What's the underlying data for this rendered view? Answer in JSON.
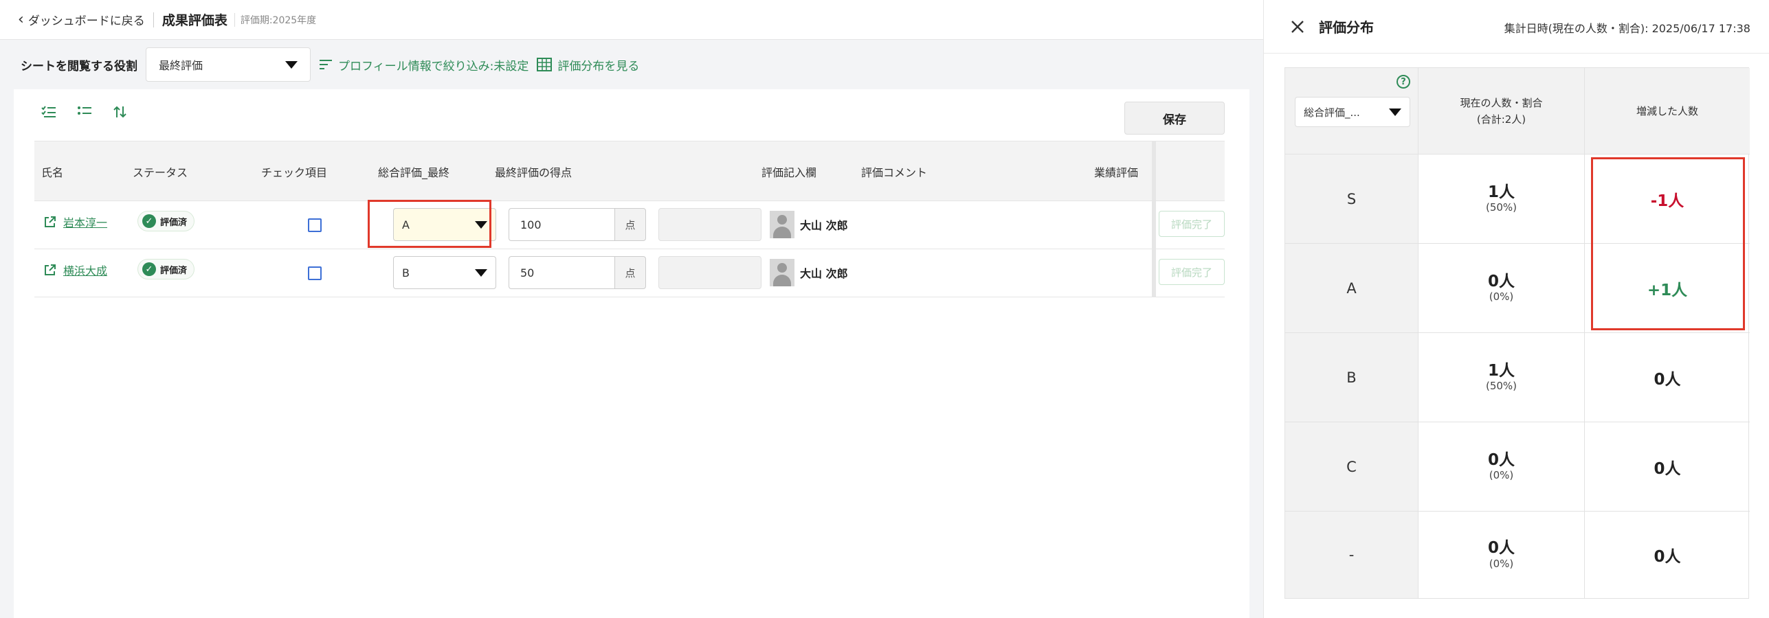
{
  "header": {
    "back_label": "ダッシュボードに戻る",
    "title": "成果評価表",
    "period": "評価期:2025年度"
  },
  "filterbar": {
    "role_label": "シートを閲覧する役割",
    "role_value": "最終評価",
    "profile_filter": "プロフィール情報で絞り込み:未設定",
    "distribution_link": "評価分布を見る"
  },
  "toolbar": {
    "save_label": "保存"
  },
  "table": {
    "columns": [
      "氏名",
      "ステータス",
      "チェック項目",
      "総合評価_最終",
      "最終評価の得点",
      "評価記入欄",
      "評価コメント",
      "業績評価"
    ],
    "rows": [
      {
        "name": "岩本淳一",
        "status": "評価済",
        "grade": "A",
        "score": "100",
        "unit": "点",
        "evaluator": "大山 次郎",
        "action": "評価完了"
      },
      {
        "name": "横浜大成",
        "status": "評価済",
        "grade": "B",
        "score": "50",
        "unit": "点",
        "evaluator": "大山 次郎",
        "action": "評価完了"
      }
    ]
  },
  "panel": {
    "title": "評価分布",
    "aggregated_at": "集計日時(現在の人数・割合):  2025/06/17 17:38",
    "select_value": "総合評価_...",
    "col_current": "現在の人数・割合",
    "col_current_sub": "(合計:2人)",
    "col_change": "増減した人数",
    "rows": [
      {
        "grade": "S",
        "count": "1人",
        "pct": "(50%)",
        "diff": "-1人"
      },
      {
        "grade": "A",
        "count": "0人",
        "pct": "(0%)",
        "diff": "+1人"
      },
      {
        "grade": "B",
        "count": "1人",
        "pct": "(50%)",
        "diff": "0人"
      },
      {
        "grade": "C",
        "count": "0人",
        "pct": "(0%)",
        "diff": "0人"
      },
      {
        "grade": "-",
        "count": "0人",
        "pct": "(0%)",
        "diff": "0人"
      }
    ]
  },
  "colors": {
    "accent_green": "#2e8b57",
    "highlight_red": "#e0392b",
    "negative": "#c8102e"
  }
}
